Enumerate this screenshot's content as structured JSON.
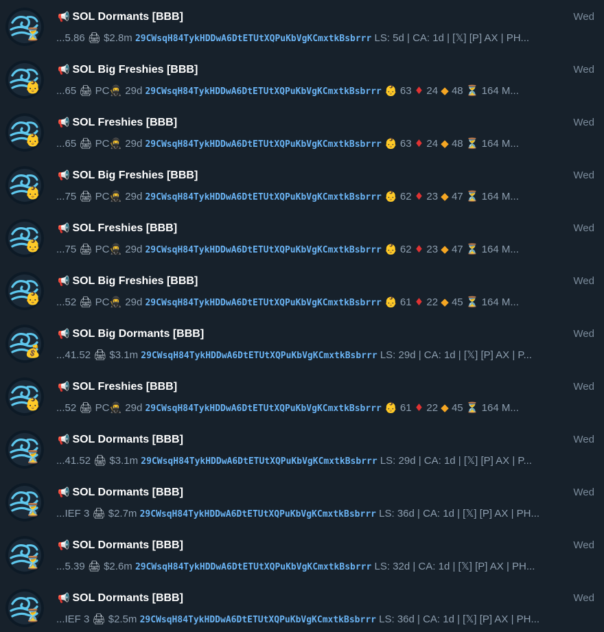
{
  "rows": [
    {
      "title": "SOL Dormants [BBB]",
      "time": "Wed",
      "badge": "hourglass",
      "badge_glyph": "⏳",
      "parts": [
        {
          "t": "...5.86 "
        },
        {
          "t": "🖨",
          "c": "emo print",
          "icon": "printer"
        },
        {
          "t": " $2.8m "
        },
        {
          "t": "29CWsqH84TykHDDwA6DtETUtXQPuKbVgKCmxtkBsbrrr",
          "c": "addr"
        },
        {
          "t": " LS: 5d | CA: 1d | [𝕏] [P] AX | PH..."
        }
      ]
    },
    {
      "title": "SOL Big Freshies [BBB]",
      "time": "Wed",
      "badge": "baby",
      "badge_glyph": "👶",
      "parts": [
        {
          "t": "...65 "
        },
        {
          "t": "🖨",
          "c": "emo print",
          "icon": "printer"
        },
        {
          "t": " PC"
        },
        {
          "t": "🥷",
          "c": "emo ninja",
          "icon": "ninja"
        },
        {
          "t": " 29d "
        },
        {
          "t": "29CWsqH84TykHDDwA6DtETUtXQPuKbVgKCmxtkBsbrrr",
          "c": "addr"
        },
        {
          "t": " "
        },
        {
          "t": "👶",
          "c": "emo skin",
          "icon": "baby"
        },
        {
          "t": " 63 "
        },
        {
          "t": "♦",
          "c": "emo red",
          "icon": "red-diamond"
        },
        {
          "t": " 24 "
        },
        {
          "t": "◆",
          "c": "emo orange",
          "icon": "orange-diamond"
        },
        {
          "t": " 48 "
        },
        {
          "t": "⏳",
          "c": "emo sand",
          "icon": "hourglass"
        },
        {
          "t": " 164 M..."
        }
      ]
    },
    {
      "title": "SOL Freshies [BBB]",
      "time": "Wed",
      "badge": "baby",
      "badge_glyph": "👶",
      "parts": [
        {
          "t": "...65 "
        },
        {
          "t": "🖨",
          "c": "emo print",
          "icon": "printer"
        },
        {
          "t": " PC"
        },
        {
          "t": "🥷",
          "c": "emo ninja",
          "icon": "ninja"
        },
        {
          "t": " 29d "
        },
        {
          "t": "29CWsqH84TykHDDwA6DtETUtXQPuKbVgKCmxtkBsbrrr",
          "c": "addr"
        },
        {
          "t": " "
        },
        {
          "t": "👶",
          "c": "emo skin",
          "icon": "baby"
        },
        {
          "t": " 63 "
        },
        {
          "t": "♦",
          "c": "emo red",
          "icon": "red-diamond"
        },
        {
          "t": " 24 "
        },
        {
          "t": "◆",
          "c": "emo orange",
          "icon": "orange-diamond"
        },
        {
          "t": " 48 "
        },
        {
          "t": "⏳",
          "c": "emo sand",
          "icon": "hourglass"
        },
        {
          "t": " 164 M..."
        }
      ]
    },
    {
      "title": "SOL Big Freshies [BBB]",
      "time": "Wed",
      "badge": "baby",
      "badge_glyph": "👶",
      "parts": [
        {
          "t": "...75 "
        },
        {
          "t": "🖨",
          "c": "emo print",
          "icon": "printer"
        },
        {
          "t": " PC"
        },
        {
          "t": "🥷",
          "c": "emo ninja",
          "icon": "ninja"
        },
        {
          "t": " 29d "
        },
        {
          "t": "29CWsqH84TykHDDwA6DtETUtXQPuKbVgKCmxtkBsbrrr",
          "c": "addr"
        },
        {
          "t": " "
        },
        {
          "t": "👶",
          "c": "emo skin",
          "icon": "baby"
        },
        {
          "t": " 62 "
        },
        {
          "t": "♦",
          "c": "emo red",
          "icon": "red-diamond"
        },
        {
          "t": " 23 "
        },
        {
          "t": "◆",
          "c": "emo orange",
          "icon": "orange-diamond"
        },
        {
          "t": " 47 "
        },
        {
          "t": "⏳",
          "c": "emo sand",
          "icon": "hourglass"
        },
        {
          "t": " 164 M..."
        }
      ]
    },
    {
      "title": "SOL Freshies [BBB]",
      "time": "Wed",
      "badge": "baby",
      "badge_glyph": "👶",
      "parts": [
        {
          "t": "...75 "
        },
        {
          "t": "🖨",
          "c": "emo print",
          "icon": "printer"
        },
        {
          "t": " PC"
        },
        {
          "t": "🥷",
          "c": "emo ninja",
          "icon": "ninja"
        },
        {
          "t": " 29d "
        },
        {
          "t": "29CWsqH84TykHDDwA6DtETUtXQPuKbVgKCmxtkBsbrrr",
          "c": "addr"
        },
        {
          "t": " "
        },
        {
          "t": "👶",
          "c": "emo skin",
          "icon": "baby"
        },
        {
          "t": " 62 "
        },
        {
          "t": "♦",
          "c": "emo red",
          "icon": "red-diamond"
        },
        {
          "t": " 23 "
        },
        {
          "t": "◆",
          "c": "emo orange",
          "icon": "orange-diamond"
        },
        {
          "t": " 47 "
        },
        {
          "t": "⏳",
          "c": "emo sand",
          "icon": "hourglass"
        },
        {
          "t": " 164 M..."
        }
      ]
    },
    {
      "title": "SOL Big Freshies [BBB]",
      "time": "Wed",
      "badge": "baby",
      "badge_glyph": "👶",
      "parts": [
        {
          "t": "...52 "
        },
        {
          "t": "🖨",
          "c": "emo print",
          "icon": "printer"
        },
        {
          "t": " PC"
        },
        {
          "t": "🥷",
          "c": "emo ninja",
          "icon": "ninja"
        },
        {
          "t": " 29d "
        },
        {
          "t": "29CWsqH84TykHDDwA6DtETUtXQPuKbVgKCmxtkBsbrrr",
          "c": "addr"
        },
        {
          "t": " "
        },
        {
          "t": "👶",
          "c": "emo skin",
          "icon": "baby"
        },
        {
          "t": " 61 "
        },
        {
          "t": "♦",
          "c": "emo red",
          "icon": "red-diamond"
        },
        {
          "t": " 22 "
        },
        {
          "t": "◆",
          "c": "emo orange",
          "icon": "orange-diamond"
        },
        {
          "t": " 45 "
        },
        {
          "t": "⏳",
          "c": "emo sand",
          "icon": "hourglass"
        },
        {
          "t": " 164 M..."
        }
      ]
    },
    {
      "title": "SOL Big Dormants [BBB]",
      "time": "Wed",
      "badge": "money-bag",
      "badge_glyph": "💰",
      "parts": [
        {
          "t": "...41.52 "
        },
        {
          "t": "🖨",
          "c": "emo print",
          "icon": "printer"
        },
        {
          "t": " $3.1m "
        },
        {
          "t": "29CWsqH84TykHDDwA6DtETUtXQPuKbVgKCmxtkBsbrrr",
          "c": "addr"
        },
        {
          "t": " LS: 29d | CA: 1d | [𝕏] [P] AX | P..."
        }
      ]
    },
    {
      "title": "SOL Freshies [BBB]",
      "time": "Wed",
      "badge": "baby",
      "badge_glyph": "👶",
      "parts": [
        {
          "t": "...52 "
        },
        {
          "t": "🖨",
          "c": "emo print",
          "icon": "printer"
        },
        {
          "t": " PC"
        },
        {
          "t": "🥷",
          "c": "emo ninja",
          "icon": "ninja"
        },
        {
          "t": " 29d "
        },
        {
          "t": "29CWsqH84TykHDDwA6DtETUtXQPuKbVgKCmxtkBsbrrr",
          "c": "addr"
        },
        {
          "t": " "
        },
        {
          "t": "👶",
          "c": "emo skin",
          "icon": "baby"
        },
        {
          "t": " 61 "
        },
        {
          "t": "♦",
          "c": "emo red",
          "icon": "red-diamond"
        },
        {
          "t": " 22 "
        },
        {
          "t": "◆",
          "c": "emo orange",
          "icon": "orange-diamond"
        },
        {
          "t": " 45 "
        },
        {
          "t": "⏳",
          "c": "emo sand",
          "icon": "hourglass"
        },
        {
          "t": " 164 M..."
        }
      ]
    },
    {
      "title": "SOL Dormants [BBB]",
      "time": "Wed",
      "badge": "hourglass",
      "badge_glyph": "⏳",
      "parts": [
        {
          "t": "...41.52 "
        },
        {
          "t": "🖨",
          "c": "emo print",
          "icon": "printer"
        },
        {
          "t": " $3.1m "
        },
        {
          "t": "29CWsqH84TykHDDwA6DtETUtXQPuKbVgKCmxtkBsbrrr",
          "c": "addr"
        },
        {
          "t": " LS: 29d | CA: 1d | [𝕏] [P] AX | P..."
        }
      ]
    },
    {
      "title": "SOL Dormants [BBB]",
      "time": "Wed",
      "badge": "hourglass",
      "badge_glyph": "⏳",
      "parts": [
        {
          "t": "...IEF 3 "
        },
        {
          "t": "🖨",
          "c": "emo print",
          "icon": "printer"
        },
        {
          "t": " $2.7m "
        },
        {
          "t": "29CWsqH84TykHDDwA6DtETUtXQPuKbVgKCmxtkBsbrrr",
          "c": "addr"
        },
        {
          "t": " LS: 36d | CA: 1d | [𝕏] [P] AX | PH..."
        }
      ]
    },
    {
      "title": "SOL Dormants [BBB]",
      "time": "Wed",
      "badge": "hourglass",
      "badge_glyph": "⏳",
      "parts": [
        {
          "t": "...5.39 "
        },
        {
          "t": "🖨",
          "c": "emo print",
          "icon": "printer"
        },
        {
          "t": " $2.6m "
        },
        {
          "t": "29CWsqH84TykHDDwA6DtETUtXQPuKbVgKCmxtkBsbrrr",
          "c": "addr"
        },
        {
          "t": " LS: 32d | CA: 1d | [𝕏] [P] AX | PH..."
        }
      ]
    },
    {
      "title": "SOL Dormants [BBB]",
      "time": "Wed",
      "badge": "hourglass",
      "badge_glyph": "⏳",
      "parts": [
        {
          "t": "...IEF 3 "
        },
        {
          "t": "🖨",
          "c": "emo print",
          "icon": "printer"
        },
        {
          "t": " $2.5m "
        },
        {
          "t": "29CWsqH84TykHDDwA6DtETUtXQPuKbVgKCmxtkBsbrrr",
          "c": "addr"
        },
        {
          "t": " LS: 36d | CA: 1d | [𝕏] [P] AX | PH..."
        }
      ]
    }
  ],
  "megaphone_glyph": "📢",
  "colors": {
    "background": "#17212b",
    "title": "#ffffff",
    "preview": "#8d9eaf",
    "time": "#7b8b9b",
    "address_link": "#6ab3f3",
    "avatar_bg": "#0d1a26",
    "avatar_wave": "#5ec8ee"
  }
}
